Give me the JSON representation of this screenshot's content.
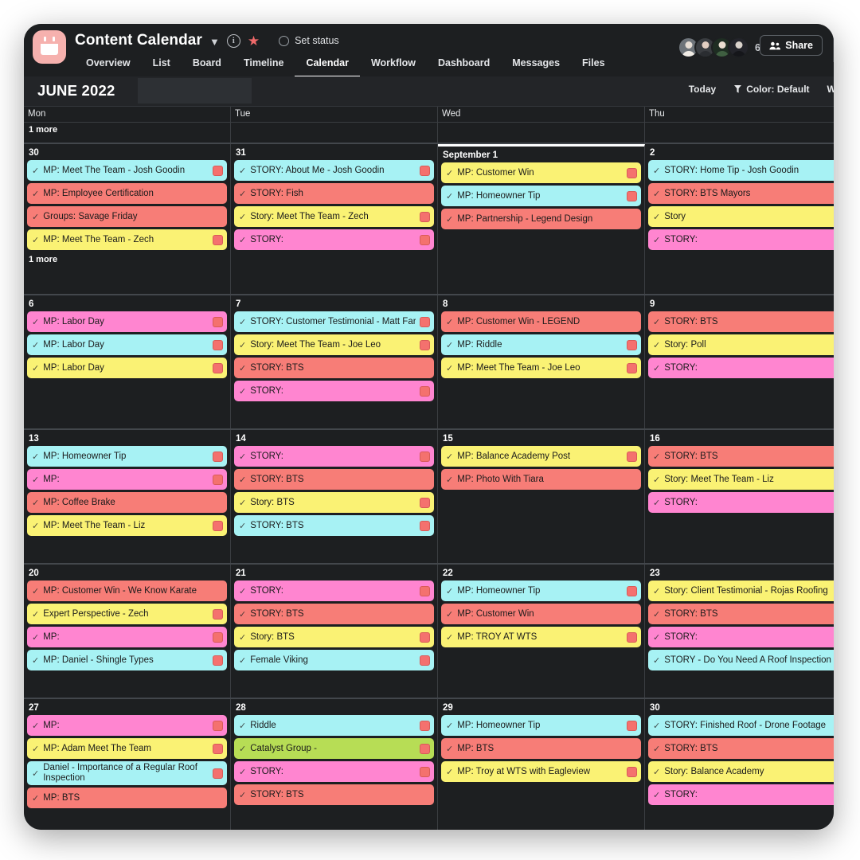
{
  "header": {
    "project_title": "Content Calendar",
    "chevron_icon": "chevron-down-icon",
    "info_icon": "info-icon",
    "star_icon": "star-icon",
    "set_status": "Set status",
    "tabs": [
      {
        "label": "Overview",
        "active": false
      },
      {
        "label": "List",
        "active": false
      },
      {
        "label": "Board",
        "active": false
      },
      {
        "label": "Timeline",
        "active": false
      },
      {
        "label": "Calendar",
        "active": true
      },
      {
        "label": "Workflow",
        "active": false
      },
      {
        "label": "Dashboard",
        "active": false
      },
      {
        "label": "Messages",
        "active": false
      },
      {
        "label": "Files",
        "active": false
      }
    ],
    "member_count": "6",
    "share_label": "Share"
  },
  "toolbar": {
    "month_label": "JUNE 2022",
    "today_label": "Today",
    "color_label": "Color: Default",
    "view_label": "Wee",
    "color_icon": "paint-bucket-icon"
  },
  "calendar": {
    "weekdays": [
      "Mon",
      "Tue",
      "Wed",
      "Thu"
    ],
    "colors": {
      "cyan": "#a7f2f4",
      "salmon": "#f77d77",
      "yellow": "#faf274",
      "pink": "#ff85d0",
      "green": "#b7dd55",
      "badge": "#f4716e",
      "background": "#1d1f21",
      "today_marker": "#ffffff"
    },
    "top_row": [
      {
        "more": "1 more"
      },
      {
        "more": ""
      },
      {
        "more": ""
      },
      {
        "more": ""
      }
    ],
    "weeks": [
      {
        "days": [
          {
            "num": "30",
            "today": false,
            "more_top": "",
            "more_bottom": "1 more",
            "events": [
              {
                "text": "MP: Meet The Team - Josh Goodin",
                "color": "cyan",
                "badge": true
              },
              {
                "text": "MP: Employee Certification",
                "color": "salmon",
                "badge": false
              },
              {
                "text": "Groups: Savage Friday",
                "color": "salmon",
                "badge": false
              },
              {
                "text": "MP: Meet The Team - Zech",
                "color": "yellow",
                "badge": true
              }
            ]
          },
          {
            "num": "31",
            "today": false,
            "more_top": "",
            "more_bottom": "",
            "events": [
              {
                "text": "STORY: About Me - Josh Goodin",
                "color": "cyan",
                "badge": true
              },
              {
                "text": "STORY: Fish",
                "color": "salmon",
                "badge": false
              },
              {
                "text": "Story: Meet The Team - Zech",
                "color": "yellow",
                "badge": true
              },
              {
                "text": "STORY:",
                "color": "pink",
                "badge": true
              }
            ]
          },
          {
            "num": "September 1",
            "today": true,
            "more_top": "",
            "more_bottom": "",
            "events": [
              {
                "text": "MP: Customer Win",
                "color": "yellow",
                "badge": true
              },
              {
                "text": "MP: Homeowner Tip",
                "color": "cyan",
                "badge": true
              },
              {
                "text": "MP: Partnership - Legend Design",
                "color": "salmon",
                "badge": false
              }
            ]
          },
          {
            "num": "2",
            "today": false,
            "more_top": "",
            "more_bottom": "",
            "events": [
              {
                "text": "STORY: Home Tip - Josh Goodin",
                "color": "cyan",
                "badge": false
              },
              {
                "text": "STORY: BTS Mayors",
                "color": "salmon",
                "badge": false
              },
              {
                "text": "Story",
                "color": "yellow",
                "badge": false
              },
              {
                "text": "STORY:",
                "color": "pink",
                "badge": false
              }
            ]
          }
        ]
      },
      {
        "days": [
          {
            "num": "6",
            "today": false,
            "more_top": "",
            "more_bottom": "",
            "events": [
              {
                "text": "MP: Labor Day",
                "color": "pink",
                "badge": true
              },
              {
                "text": "MP: Labor Day",
                "color": "cyan",
                "badge": true
              },
              {
                "text": "MP: Labor Day",
                "color": "yellow",
                "badge": true
              }
            ]
          },
          {
            "num": "7",
            "today": false,
            "more_top": "",
            "more_bottom": "",
            "events": [
              {
                "text": "STORY: Customer Testimonial - Matt Farrell",
                "color": "cyan",
                "badge": true
              },
              {
                "text": "Story: Meet The Team - Joe Leo",
                "color": "yellow",
                "badge": true
              },
              {
                "text": "STORY: BTS",
                "color": "salmon",
                "badge": false
              },
              {
                "text": "STORY:",
                "color": "pink",
                "badge": true
              }
            ]
          },
          {
            "num": "8",
            "today": false,
            "more_top": "",
            "more_bottom": "",
            "events": [
              {
                "text": "MP: Customer Win - LEGEND",
                "color": "salmon",
                "badge": false
              },
              {
                "text": "MP: Riddle",
                "color": "cyan",
                "badge": true
              },
              {
                "text": "MP: Meet The Team - Joe Leo",
                "color": "yellow",
                "badge": true
              }
            ]
          },
          {
            "num": "9",
            "today": false,
            "more_top": "",
            "more_bottom": "",
            "events": [
              {
                "text": "STORY: BTS",
                "color": "salmon",
                "badge": false
              },
              {
                "text": "Story: Poll",
                "color": "yellow",
                "badge": false
              },
              {
                "text": "STORY:",
                "color": "pink",
                "badge": false
              }
            ]
          }
        ]
      },
      {
        "days": [
          {
            "num": "13",
            "today": false,
            "more_top": "",
            "more_bottom": "",
            "events": [
              {
                "text": "MP: Homeowner Tip",
                "color": "cyan",
                "badge": true
              },
              {
                "text": "MP:",
                "color": "pink",
                "badge": true
              },
              {
                "text": "MP: Coffee Brake",
                "color": "salmon",
                "badge": false
              },
              {
                "text": "MP: Meet The Team - Liz",
                "color": "yellow",
                "badge": true
              }
            ]
          },
          {
            "num": "14",
            "today": false,
            "more_top": "",
            "more_bottom": "",
            "events": [
              {
                "text": "STORY:",
                "color": "pink",
                "badge": true
              },
              {
                "text": "STORY: BTS",
                "color": "salmon",
                "badge": false
              },
              {
                "text": "Story: BTS",
                "color": "yellow",
                "badge": true
              },
              {
                "text": "STORY: BTS",
                "color": "cyan",
                "badge": true
              }
            ]
          },
          {
            "num": "15",
            "today": false,
            "more_top": "",
            "more_bottom": "",
            "events": [
              {
                "text": "MP: Balance Academy Post",
                "color": "yellow",
                "badge": true
              },
              {
                "text": "MP: Photo With Tiara",
                "color": "salmon",
                "badge": false
              }
            ]
          },
          {
            "num": "16",
            "today": false,
            "more_top": "",
            "more_bottom": "",
            "events": [
              {
                "text": "STORY: BTS",
                "color": "salmon",
                "badge": false
              },
              {
                "text": "Story: Meet The Team - Liz",
                "color": "yellow",
                "badge": false
              },
              {
                "text": "STORY:",
                "color": "pink",
                "badge": false
              }
            ]
          }
        ]
      },
      {
        "days": [
          {
            "num": "20",
            "today": false,
            "more_top": "",
            "more_bottom": "",
            "events": [
              {
                "text": "MP: Customer Win - We Know Karate",
                "color": "salmon",
                "badge": false
              },
              {
                "text": "Expert Perspective - Zech",
                "color": "yellow",
                "badge": true
              },
              {
                "text": "MP:",
                "color": "pink",
                "badge": true
              },
              {
                "text": "MP: Daniel - Shingle Types",
                "color": "cyan",
                "badge": true
              }
            ]
          },
          {
            "num": "21",
            "today": false,
            "more_top": "",
            "more_bottom": "",
            "events": [
              {
                "text": "STORY:",
                "color": "pink",
                "badge": true
              },
              {
                "text": "STORY: BTS",
                "color": "salmon",
                "badge": false
              },
              {
                "text": "Story: BTS",
                "color": "yellow",
                "badge": true
              },
              {
                "text": "Female Viking",
                "color": "cyan",
                "badge": true
              }
            ]
          },
          {
            "num": "22",
            "today": false,
            "more_top": "",
            "more_bottom": "",
            "events": [
              {
                "text": "MP: Homeowner Tip",
                "color": "cyan",
                "badge": true
              },
              {
                "text": "MP: Customer Win",
                "color": "salmon",
                "badge": false
              },
              {
                "text": "MP: TROY AT WTS",
                "color": "yellow",
                "badge": true
              }
            ]
          },
          {
            "num": "23",
            "today": false,
            "more_top": "",
            "more_bottom": "",
            "events": [
              {
                "text": "Story: Client Testimonial - Rojas Roofing",
                "color": "yellow",
                "badge": false
              },
              {
                "text": "STORY: BTS",
                "color": "salmon",
                "badge": false
              },
              {
                "text": "STORY:",
                "color": "pink",
                "badge": false
              },
              {
                "text": "STORY - Do You Need A Roof Inspection",
                "color": "cyan",
                "badge": false
              }
            ]
          }
        ]
      },
      {
        "days": [
          {
            "num": "27",
            "today": false,
            "more_top": "",
            "more_bottom": "",
            "events": [
              {
                "text": "MP:",
                "color": "pink",
                "badge": true
              },
              {
                "text": "MP: Adam Meet The Team",
                "color": "yellow",
                "badge": true
              },
              {
                "text": "Daniel - Importance of a Regular Roof Inspection",
                "color": "cyan",
                "badge": true,
                "two_line": true
              },
              {
                "text": "MP: BTS",
                "color": "salmon",
                "badge": false
              }
            ]
          },
          {
            "num": "28",
            "today": false,
            "more_top": "",
            "more_bottom": "",
            "events": [
              {
                "text": "Riddle",
                "color": "cyan",
                "badge": true
              },
              {
                "text": "Catalyst Group -",
                "color": "green",
                "badge": true
              },
              {
                "text": "STORY:",
                "color": "pink",
                "badge": true
              },
              {
                "text": "STORY: BTS",
                "color": "salmon",
                "badge": false
              }
            ]
          },
          {
            "num": "29",
            "today": false,
            "more_top": "",
            "more_bottom": "",
            "events": [
              {
                "text": "MP: Homeowner Tip",
                "color": "cyan",
                "badge": true
              },
              {
                "text": "MP: BTS",
                "color": "salmon",
                "badge": false
              },
              {
                "text": "MP: Troy at WTS with Eagleview",
                "color": "yellow",
                "badge": true
              }
            ]
          },
          {
            "num": "30",
            "today": false,
            "more_top": "",
            "more_bottom": "",
            "events": [
              {
                "text": "STORY: Finished Roof - Drone Footage",
                "color": "cyan",
                "badge": false
              },
              {
                "text": "STORY: BTS",
                "color": "salmon",
                "badge": false
              },
              {
                "text": "Story: Balance Academy",
                "color": "yellow",
                "badge": false
              },
              {
                "text": "STORY:",
                "color": "pink",
                "badge": false
              }
            ]
          }
        ]
      }
    ]
  }
}
